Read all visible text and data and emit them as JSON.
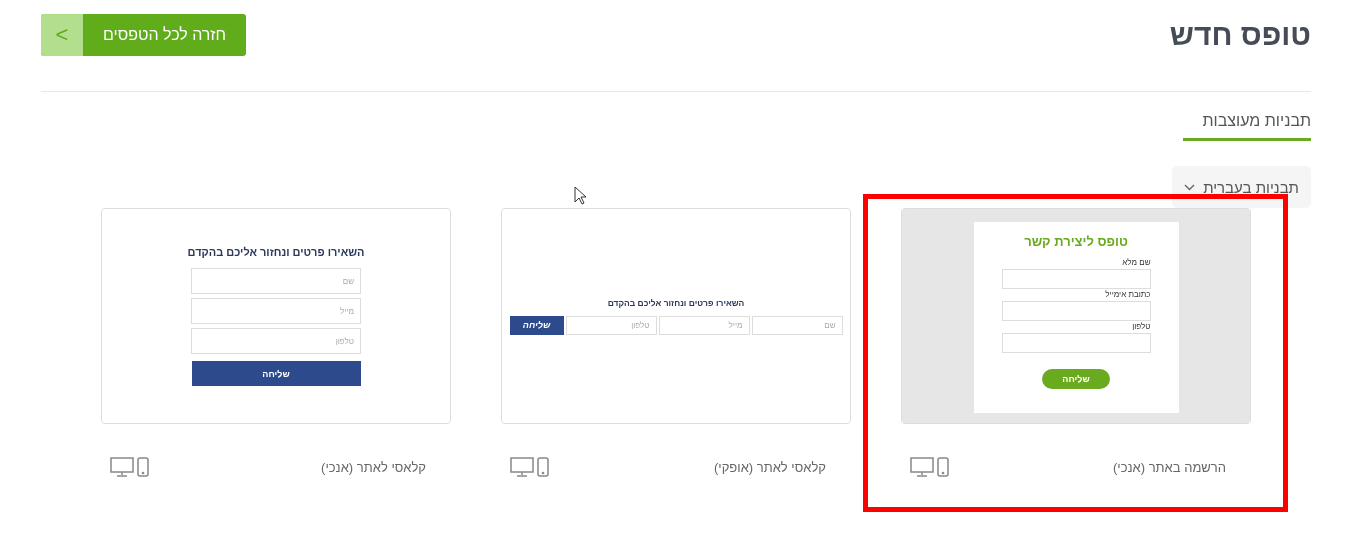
{
  "header": {
    "title": "טופס חדש",
    "back_button": {
      "label": "חזרה לכל הטפסים",
      "arrow": ">"
    }
  },
  "tabs": [
    {
      "label": "תבניות מעוצבות",
      "selected": true
    }
  ],
  "language_dropdown": {
    "label": "תבניות בעברית"
  },
  "templates": [
    {
      "name": "הרשמה באתר (אנכי)",
      "highlighted": true,
      "preview": {
        "kind": "signup",
        "title": "טופס ליצירת קשר",
        "fields": [
          "שם מלא",
          "כתובת אימייל",
          "טלפון"
        ],
        "button": "שליחה"
      }
    },
    {
      "name": "קלאסי לאתר (אופקי)",
      "highlighted": false,
      "preview": {
        "kind": "horizontal",
        "title": "השאירו פרטים ונחזור אליכם בהקדם",
        "fields": [
          "שם",
          "מייל",
          "טלפון"
        ],
        "button": "שליחה"
      }
    },
    {
      "name": "קלאסי לאתר (אנכי)",
      "highlighted": false,
      "preview": {
        "kind": "vertical",
        "title": "השאירו פרטים ונחזור אליכם בהקדם",
        "fields": [
          "שם",
          "מייל",
          "טלפון"
        ],
        "button": "שליחה"
      }
    }
  ]
}
